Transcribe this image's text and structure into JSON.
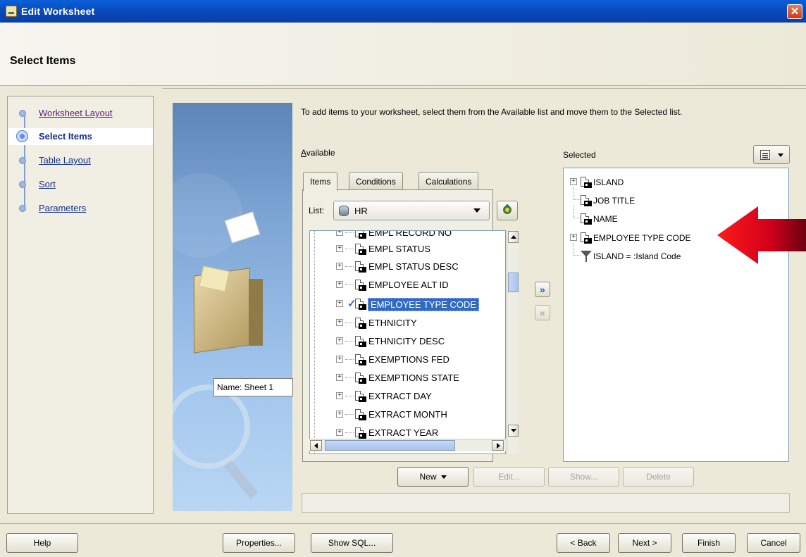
{
  "window": {
    "title": "Edit Worksheet",
    "close_glyph": "✕"
  },
  "header": {
    "title": "Select Items"
  },
  "nav": {
    "items": [
      {
        "label": "Worksheet Layout",
        "state": "visited"
      },
      {
        "label": "Select Items",
        "state": "active"
      },
      {
        "label": "Table Layout",
        "state": "link"
      },
      {
        "label": "Sort",
        "state": "link"
      },
      {
        "label": "Parameters",
        "state": "link"
      }
    ]
  },
  "art": {
    "name_label": "Name:  Sheet 1"
  },
  "main": {
    "instruction": "To add items to your worksheet, select them from the Available list and move them to the Selected list.",
    "available_label": "Available",
    "selected_label": "Selected",
    "tabs": [
      {
        "label": "Items",
        "active": true
      },
      {
        "label": "Conditions",
        "active": false
      },
      {
        "label": "Calculations",
        "active": false
      }
    ],
    "list_label": "List:",
    "list_value": "HR",
    "available_items": [
      {
        "label": "EMPL RECORD NO",
        "selected": false
      },
      {
        "label": "EMPL STATUS",
        "selected": false
      },
      {
        "label": "EMPL STATUS DESC",
        "selected": false
      },
      {
        "label": "EMPLOYEE ALT ID",
        "selected": false
      },
      {
        "label": "EMPLOYEE TYPE CODE",
        "selected": true
      },
      {
        "label": "ETHNICITY",
        "selected": false
      },
      {
        "label": "ETHNICITY DESC",
        "selected": false
      },
      {
        "label": "EXEMPTIONS FED",
        "selected": false
      },
      {
        "label": "EXEMPTIONS STATE",
        "selected": false
      },
      {
        "label": "EXTRACT DAY",
        "selected": false
      },
      {
        "label": "EXTRACT MONTH",
        "selected": false
      },
      {
        "label": "EXTRACT YEAR",
        "selected": false
      }
    ],
    "selected_items": [
      {
        "label": "ISLAND",
        "expandable": true,
        "kind": "item"
      },
      {
        "label": "JOB TITLE",
        "expandable": false,
        "kind": "item"
      },
      {
        "label": "NAME",
        "expandable": false,
        "kind": "item"
      },
      {
        "label": "EMPLOYEE TYPE CODE",
        "expandable": true,
        "kind": "item"
      },
      {
        "label": "ISLAND = :Island Code",
        "expandable": false,
        "kind": "condition"
      }
    ],
    "buttons": {
      "new": "New",
      "edit": "Edit...",
      "show": "Show...",
      "delete": "Delete"
    },
    "icons": [
      "database-icon",
      "filter-icon",
      "move-right-icon",
      "move-left-icon",
      "layout-menu-icon"
    ]
  },
  "footer": {
    "help": "Help",
    "properties": "Properties...",
    "show_sql": "Show SQL...",
    "back": "< Back",
    "next": "Next >",
    "finish": "Finish",
    "cancel": "Cancel"
  },
  "colors": {
    "title_bar": "#0a5fd8",
    "selection": "#316ac5",
    "annotation_arrow": "#e0001a"
  }
}
